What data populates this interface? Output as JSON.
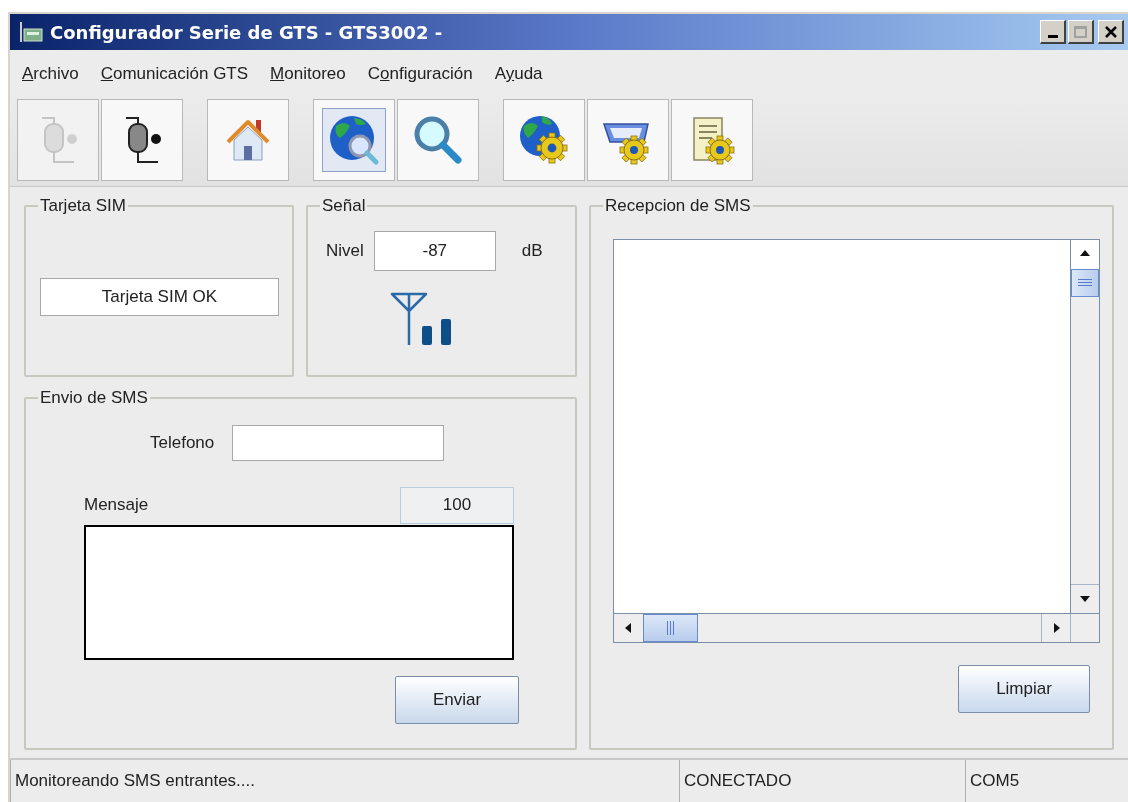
{
  "window": {
    "title": "Configurador Serie de GTS - GTS3002 -"
  },
  "menu": [
    {
      "key": "A",
      "post": "rchivo"
    },
    {
      "key": "C",
      "post": "omunicación GTS"
    },
    {
      "key": "M",
      "post": "onitoreo"
    },
    {
      "pre": "C",
      "key": "o",
      "post": "nfiguración"
    },
    {
      "pre": "A",
      "key": "y",
      "post": "uda"
    }
  ],
  "toolbar_groups": [
    [
      {
        "kind": "plug",
        "disabled": true,
        "selected": false
      },
      {
        "kind": "plug",
        "disabled": false,
        "selected": false
      }
    ],
    [
      {
        "kind": "home",
        "disabled": false,
        "selected": false
      }
    ],
    [
      {
        "kind": "globe-search",
        "disabled": false,
        "selected": true
      },
      {
        "kind": "search",
        "disabled": false,
        "selected": false
      }
    ],
    [
      {
        "kind": "globe-gear",
        "disabled": false,
        "selected": false
      },
      {
        "kind": "port-gear",
        "disabled": false,
        "selected": false
      },
      {
        "kind": "doc-gear",
        "disabled": false,
        "selected": false
      }
    ]
  ],
  "sim": {
    "title": "Tarjeta SIM",
    "status": "Tarjeta SIM OK"
  },
  "signal": {
    "title": "Señal",
    "label": "Nivel",
    "value": "-87",
    "unit": "dB"
  },
  "send": {
    "title": "Envio de SMS",
    "phone_label": "Telefono",
    "message_label": "Mensaje",
    "counter": "100",
    "button": "Enviar"
  },
  "receive": {
    "title": "Recepcion de SMS",
    "button": "Limpiar"
  },
  "status_bar": [
    "Monitoreando SMS entrantes....",
    "CONECTADO",
    "COM5"
  ]
}
